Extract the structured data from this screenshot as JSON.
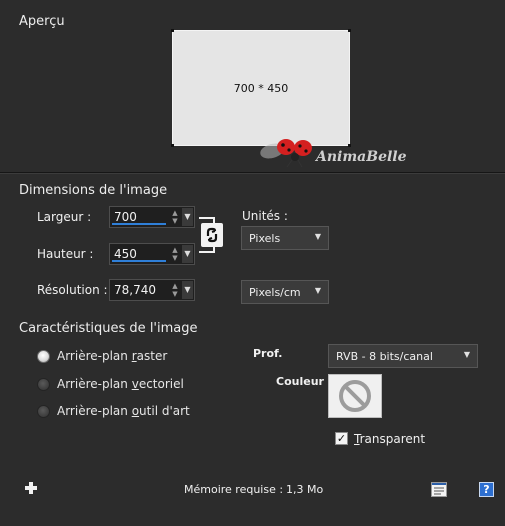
{
  "preview": {
    "title": "Aperçu",
    "size_label": "700 * 450",
    "watermark": "AnimaBelle"
  },
  "dimensions": {
    "title": "Dimensions de l'image",
    "width": {
      "label": "Largeur :",
      "value": "700"
    },
    "height": {
      "label": "Hauteur :",
      "value": "450"
    },
    "resolution": {
      "label": "Résolution :",
      "value": "78,740"
    },
    "units_label": "Unités :",
    "units_value": "Pixels",
    "resolution_unit": "Pixels/cm"
  },
  "characteristics": {
    "title": "Caractéristiques de l'image",
    "options": [
      {
        "pre": "Arrière-plan ",
        "ul": "r",
        "post": "aster",
        "selected": true
      },
      {
        "pre": "Arrière-plan ",
        "ul": "v",
        "post": "ectoriel",
        "selected": false
      },
      {
        "pre": "Arrière-plan ",
        "ul": "o",
        "post": "util d'art",
        "selected": false
      }
    ],
    "depth_label": "Prof.",
    "depth_value": "RVB - 8 bits/canal",
    "color_label": "Couleur :",
    "transparent_ul": "T",
    "transparent_rest": "ransparent",
    "transparent_checked": true
  },
  "footer": {
    "memory_label": "Mémoire requise :",
    "memory_value": "1,3 Mo"
  },
  "icons": {
    "add": "plus-icon",
    "notes": "notepad-icon",
    "help": "help-icon",
    "link": "chain-link-icon",
    "no_color": "no-color-icon"
  }
}
